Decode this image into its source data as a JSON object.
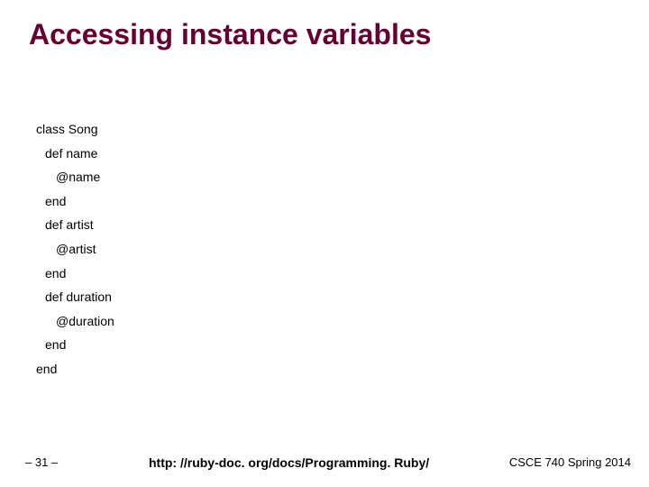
{
  "title": "Accessing instance variables",
  "code": {
    "l1": "class Song",
    "l2": "def name",
    "l3": "@name",
    "l4": "end",
    "l5": "def artist",
    "l6": "@artist",
    "l7": "end",
    "l8": "def duration",
    "l9": "@duration",
    "l10": "end",
    "l11": "end"
  },
  "footer": {
    "page": "– 31 –",
    "url": "http: //ruby-doc. org/docs/Programming. Ruby/",
    "course": "CSCE 740 Spring 2014"
  }
}
